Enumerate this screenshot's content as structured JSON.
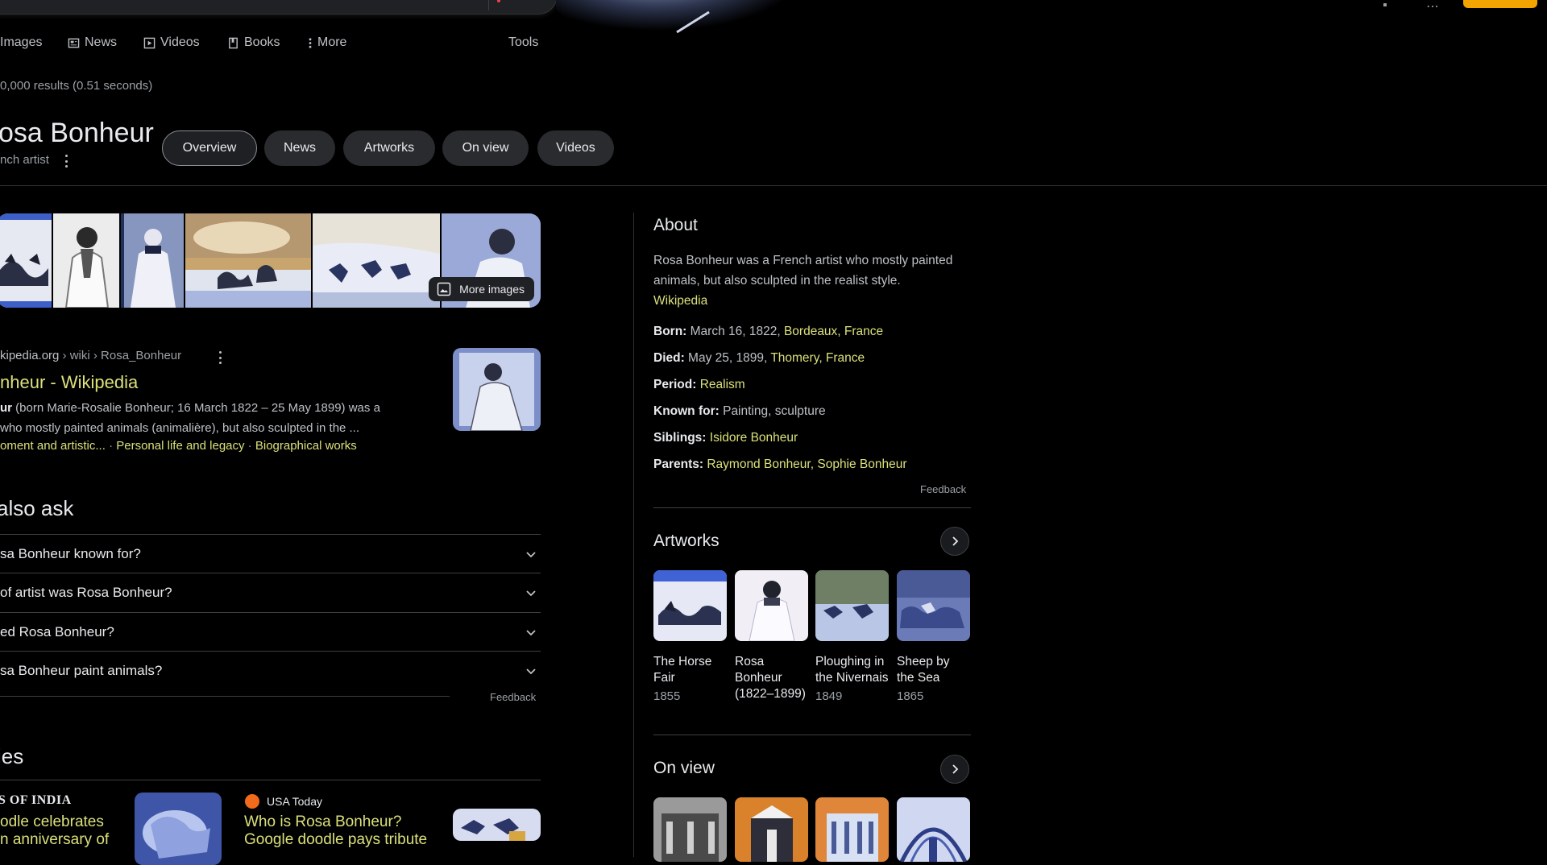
{
  "search": {
    "nav_items": [
      {
        "label": "Images",
        "icon": "none"
      },
      {
        "label": "News",
        "icon": "newspaper-icon"
      },
      {
        "label": "Videos",
        "icon": "play-box-icon"
      },
      {
        "label": "Books",
        "icon": "book-icon"
      },
      {
        "label": "More",
        "icon": "vertical-dots-icon"
      }
    ],
    "tools_label": "Tools",
    "result_stats": "0,000 results (0.51 seconds)"
  },
  "entity": {
    "title": "osa Bonheur",
    "subtitle": "nch artist",
    "chips": [
      "Overview",
      "News",
      "Artworks",
      "On view",
      "Videos"
    ],
    "active_chip": "Overview",
    "more_images_label": "More images"
  },
  "wiki_result": {
    "cite_domain": "kipedia.org",
    "cite_path": " › wiki › Rosa_Bonheur",
    "title": "nheur - Wikipedia",
    "snippet_bold": "ur",
    "snippet_line1": " (born Marie-Rosalie Bonheur; 16 March 1822 – 25 May 1899) was a",
    "snippet_line2": " who mostly painted animals (animalière), but also sculpted in the ...",
    "sublinks": [
      "oment and artistic...",
      "Personal life and legacy",
      "Biographical works"
    ],
    "separator": " · "
  },
  "people_also_ask": {
    "title": "also ask",
    "questions": [
      "sa Bonheur known for?",
      "of artist was Rosa Bonheur?",
      "ed Rosa Bonheur?",
      "sa Bonheur paint animals?"
    ],
    "feedback": "Feedback"
  },
  "top_stories": {
    "title": "ies",
    "stories": [
      {
        "source": "S OF INDIA",
        "headline_1": "odle celebrates",
        "headline_2": "n anniversary of"
      },
      {
        "source": "USA Today",
        "headline_1": "Who is Rosa Bonheur?",
        "headline_2": "Google doodle pays tribute"
      }
    ]
  },
  "knowledge_panel": {
    "about_title": "About",
    "description": "Rosa Bonheur was a French artist who mostly painted animals, but also sculpted in the realist style.",
    "source_link": "Wikipedia",
    "facts": {
      "born": {
        "label": "Born:",
        "text": " March 16, 1822, ",
        "link": "Bordeaux, France"
      },
      "died": {
        "label": "Died:",
        "text": " May 25, 1899, ",
        "link": "Thomery, France"
      },
      "period": {
        "label": "Period:",
        "text": " ",
        "link": "Realism"
      },
      "known_for": {
        "label": "Known for:",
        "text": " Painting, sculpture"
      },
      "siblings": {
        "label": "Siblings:",
        "text": " ",
        "link": "Isidore Bonheur"
      },
      "parents": {
        "label": "Parents:",
        "text": " ",
        "link1": "Raymond Bonheur",
        "comma": ", ",
        "link2": "Sophie Bonheur"
      }
    },
    "feedback": "Feedback",
    "artworks_title": "Artworks",
    "artworks": [
      {
        "name": "The Horse Fair",
        "year": "1855"
      },
      {
        "name": "Rosa Bonheur (1822–1899)",
        "year": ""
      },
      {
        "name": "Ploughing in the Nivernais",
        "year": "1849"
      },
      {
        "name": "Sheep by the Sea",
        "year": "1865"
      }
    ],
    "on_view_title": "On view"
  },
  "colors": {
    "background": "#000000",
    "link": "#dbe07a",
    "text": "#bdc1c6",
    "header_button": "#f4a400"
  }
}
